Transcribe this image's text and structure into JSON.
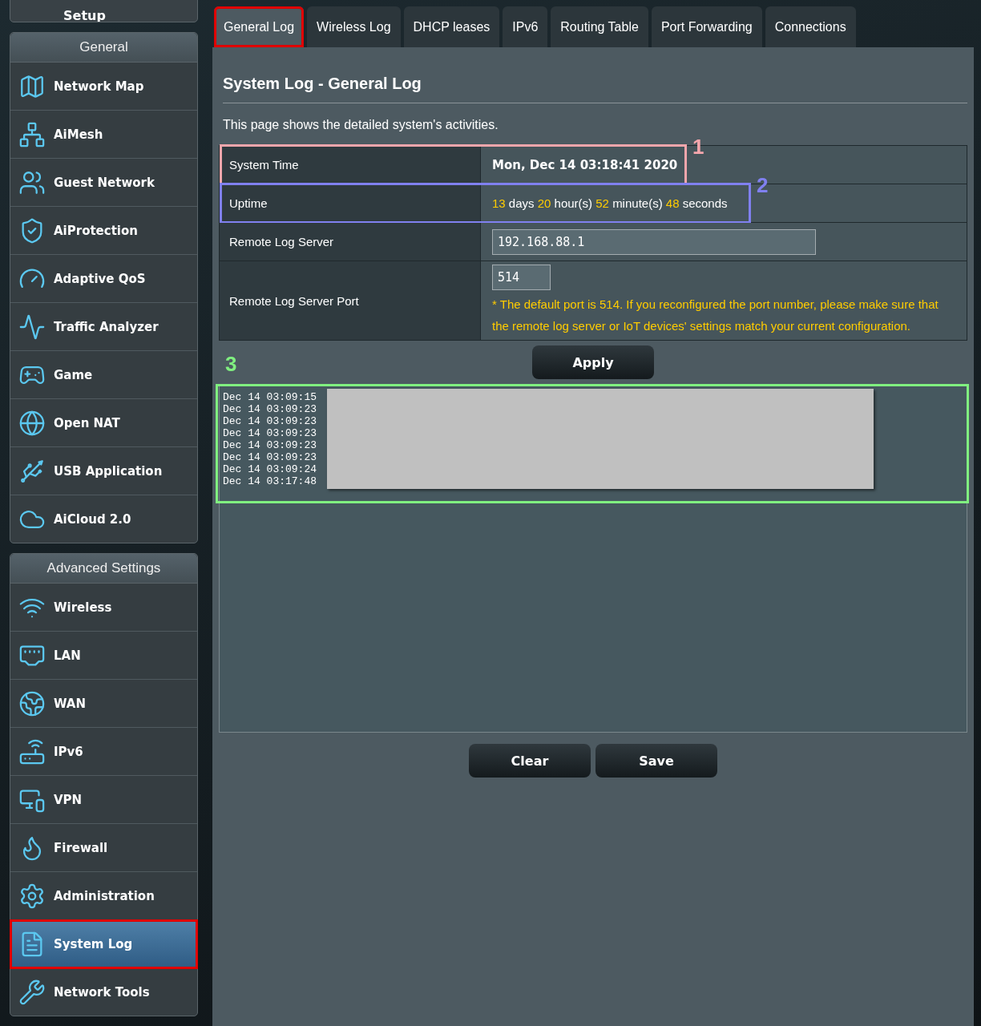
{
  "sidebar": {
    "setup": {
      "label": "Setup"
    },
    "sections": [
      {
        "title": "General",
        "items": [
          {
            "label": "Network Map",
            "selected": false
          },
          {
            "label": "AiMesh",
            "selected": false
          },
          {
            "label": "Guest Network",
            "selected": false
          },
          {
            "label": "AiProtection",
            "selected": false
          },
          {
            "label": "Adaptive QoS",
            "selected": false
          },
          {
            "label": "Traffic Analyzer",
            "selected": false
          },
          {
            "label": "Game",
            "selected": false
          },
          {
            "label": "Open NAT",
            "selected": false
          },
          {
            "label": "USB Application",
            "selected": false
          },
          {
            "label": "AiCloud 2.0",
            "selected": false
          }
        ]
      },
      {
        "title": "Advanced Settings",
        "items": [
          {
            "label": "Wireless",
            "selected": false
          },
          {
            "label": "LAN",
            "selected": false
          },
          {
            "label": "WAN",
            "selected": false
          },
          {
            "label": "IPv6",
            "selected": false
          },
          {
            "label": "VPN",
            "selected": false
          },
          {
            "label": "Firewall",
            "selected": false
          },
          {
            "label": "Administration",
            "selected": false
          },
          {
            "label": "System Log",
            "selected": true
          },
          {
            "label": "Network Tools",
            "selected": false
          }
        ]
      }
    ]
  },
  "tabs": [
    {
      "label": "General Log",
      "selected": true
    },
    {
      "label": "Wireless Log",
      "selected": false
    },
    {
      "label": "DHCP leases",
      "selected": false
    },
    {
      "label": "IPv6",
      "selected": false
    },
    {
      "label": "Routing Table",
      "selected": false
    },
    {
      "label": "Port Forwarding",
      "selected": false
    },
    {
      "label": "Connections",
      "selected": false
    }
  ],
  "page": {
    "title": "System Log - General Log",
    "description": "This page shows the detailed system's activities.",
    "rows": [
      {
        "kind": "text",
        "label": "System Time",
        "value": "Mon, Dec 14 03:18:41 2020",
        "annotation": {
          "number": "1",
          "color": "#f4a6ac"
        }
      },
      {
        "kind": "uptime",
        "label": "Uptime",
        "parts": [
          {
            "value": "13",
            "unit": "days"
          },
          {
            "value": "20",
            "unit": "hour(s)"
          },
          {
            "value": "52",
            "unit": "minute(s)"
          },
          {
            "value": "48",
            "unit": "seconds"
          }
        ],
        "annotation": {
          "number": "2",
          "color": "#8080f0"
        }
      },
      {
        "kind": "input",
        "label": "Remote Log Server",
        "value": "192.168.88.1"
      },
      {
        "kind": "port",
        "label": "Remote Log Server Port",
        "value": "514",
        "note": "* The default port is 514. If you reconfigured the port number, please make sure that the remote log server or IoT devices' settings match your current configuration."
      }
    ],
    "apply": "Apply",
    "log": {
      "annotation": {
        "number": "3",
        "color": "#80f080"
      },
      "lines": [
        "Dec 14 03:09:15",
        "Dec 14 03:09:23",
        "Dec 14 03:09:23",
        "Dec 14 03:09:23",
        "Dec 14 03:09:23",
        "Dec 14 03:09:23",
        "Dec 14 03:09:24",
        "Dec 14 03:17:48"
      ]
    },
    "buttons": [
      "Clear",
      "Save"
    ]
  }
}
